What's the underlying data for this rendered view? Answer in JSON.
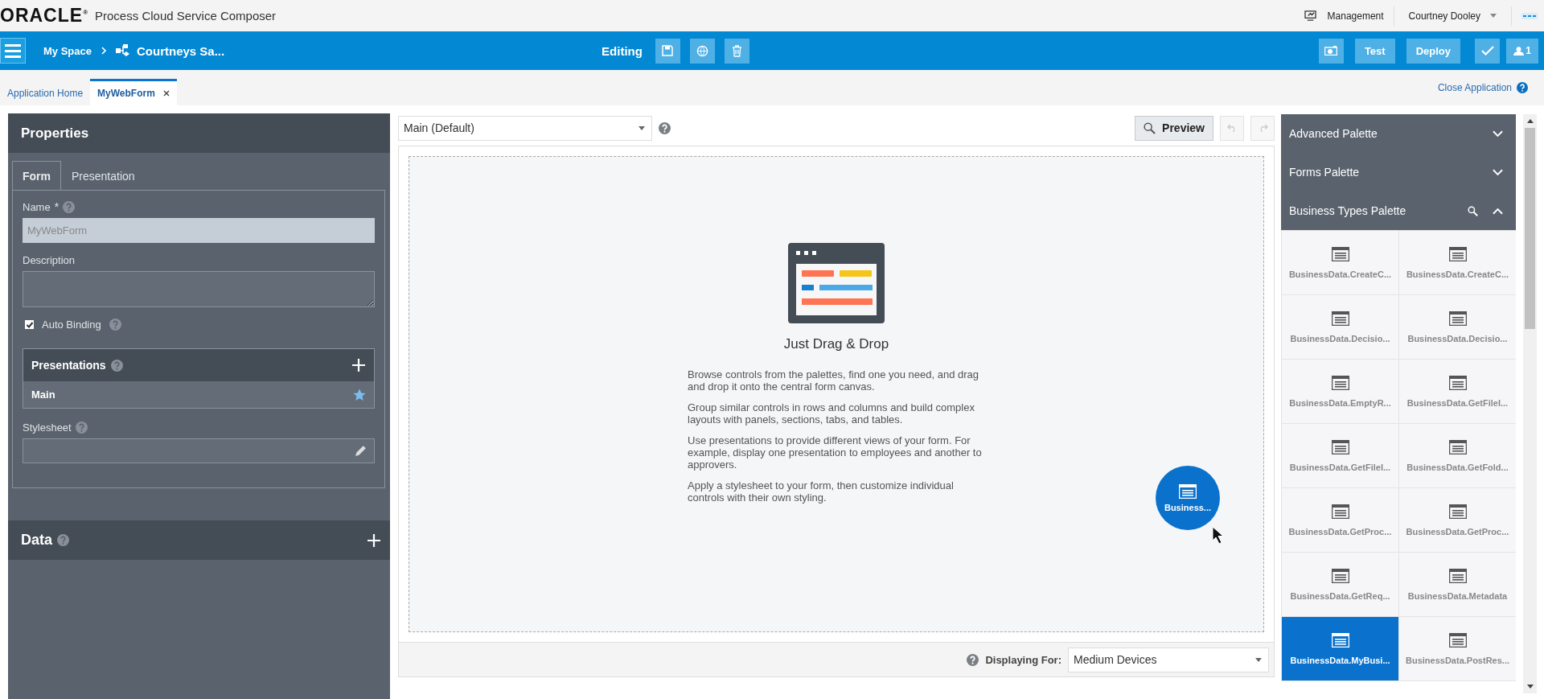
{
  "app": {
    "logo": "ORACLE$^{®}$",
    "title": "Process Cloud Service Composer"
  },
  "header_links": [
    {
      "label": "Management",
      "kind": "link"
    },
    {
      "label": "Courtney Dooley",
      "kind": "dropdown"
    }
  ],
  "toolbar": {
    "breadcrumb": [
      "My Space",
      "Courtneys Sa..."
    ],
    "status": "Editing",
    "buttons": [
      "Test",
      "Deploy"
    ],
    "user_count": "1"
  },
  "tabs": [
    {
      "label": "Application Home",
      "selected": false,
      "closable": false
    },
    {
      "label": "MyWebForm",
      "selected": true,
      "closable": true
    }
  ],
  "close_application": "Close Application",
  "properties": {
    "title": "Properties",
    "tabs": [
      {
        "label": "Form",
        "selected": true
      },
      {
        "label": "Presentation",
        "selected": false
      }
    ],
    "name_label": "Name",
    "required_mark": "*",
    "name_value": "MyWebForm",
    "name_disabled": true,
    "description_label": "Description",
    "auto_binding": {
      "label": "Auto Binding",
      "checked": true
    },
    "presentations": {
      "title": "Presentations",
      "items": [
        {
          "label": "Main",
          "default": true
        }
      ]
    },
    "stylesheet_label": "Stylesheet"
  },
  "data_section": {
    "title": "Data"
  },
  "canvas": {
    "presentation_select": "Main (Default)",
    "preview": "Preview",
    "heading": "Just Drag & Drop",
    "paragraphs": [
      "Browse controls from the palettes, find one you need, and drag and drop it onto the central form canvas.",
      "Group similar controls in rows and columns and build complex layouts with panels, sections, tabs, and tables.",
      "Use presentations to provide different views of your form. For example, display one presentation to employees and another to approvers.",
      "Apply a stylesheet to your form, then customize individual controls with their own styling."
    ],
    "drag_item": "Business...",
    "displaying_for_label": "Displaying For:",
    "device": "Medium Devices"
  },
  "palettes": [
    {
      "title": "Advanced Palette",
      "expanded": false,
      "searchable": false
    },
    {
      "title": "Forms Palette",
      "expanded": false,
      "searchable": false
    },
    {
      "title": "Business Types Palette",
      "expanded": true,
      "searchable": true,
      "items": [
        {
          "label": "BusinessData.CreateC...",
          "selected": false
        },
        {
          "label": "BusinessData.CreateC...",
          "selected": false
        },
        {
          "label": "BusinessData.Decisio...",
          "selected": false
        },
        {
          "label": "BusinessData.Decisio...",
          "selected": false
        },
        {
          "label": "BusinessData.EmptyR...",
          "selected": false
        },
        {
          "label": "BusinessData.GetFileI...",
          "selected": false
        },
        {
          "label": "BusinessData.GetFileI...",
          "selected": false
        },
        {
          "label": "BusinessData.GetFold...",
          "selected": false
        },
        {
          "label": "BusinessData.GetProc...",
          "selected": false
        },
        {
          "label": "BusinessData.GetProc...",
          "selected": false
        },
        {
          "label": "BusinessData.GetReq...",
          "selected": false
        },
        {
          "label": "BusinessData.Metadata",
          "selected": false
        },
        {
          "label": "BusinessData.MyBusi...",
          "selected": true
        },
        {
          "label": "BusinessData.PostRes...",
          "selected": false
        }
      ]
    }
  ]
}
